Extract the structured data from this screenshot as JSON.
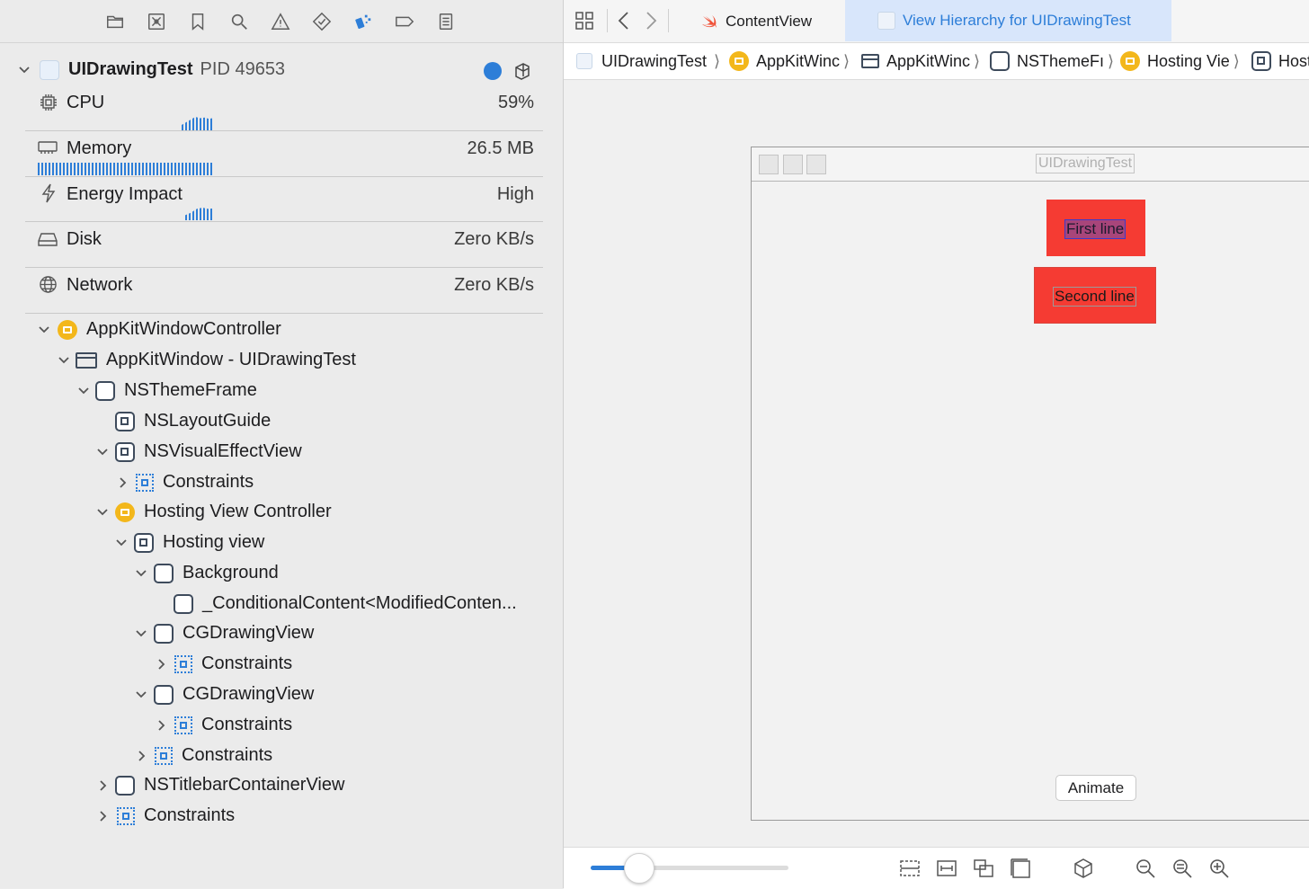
{
  "toolbar": {
    "icons": [
      "folder-icon",
      "source-control-icon",
      "bookmark-icon",
      "find-icon",
      "warning-icon",
      "test-icon",
      "debug-icon",
      "breakpoint-icon",
      "report-icon"
    ]
  },
  "process": {
    "name": "UIDrawingTest",
    "pid": "PID 49653"
  },
  "gauges": [
    {
      "label": "CPU",
      "value": "59%"
    },
    {
      "label": "Memory",
      "value": "26.5 MB"
    },
    {
      "label": "Energy Impact",
      "value": "High"
    },
    {
      "label": "Disk",
      "value": "Zero KB/s"
    },
    {
      "label": "Network",
      "value": "Zero KB/s"
    }
  ],
  "tree": [
    {
      "label": "AppKitWindowController"
    },
    {
      "label": "AppKitWindow - UIDrawingTest"
    },
    {
      "label": "NSThemeFrame"
    },
    {
      "label": "NSLayoutGuide"
    },
    {
      "label": "NSVisualEffectView"
    },
    {
      "label": "Constraints"
    },
    {
      "label": "Hosting View Controller"
    },
    {
      "label": "Hosting view"
    },
    {
      "label": "Background"
    },
    {
      "label": "_ConditionalContent<ModifiedConten..."
    },
    {
      "label": "CGDrawingView"
    },
    {
      "label": "Constraints"
    },
    {
      "label": "CGDrawingView"
    },
    {
      "label": "Constraints"
    },
    {
      "label": "Constraints"
    },
    {
      "label": "NSTitlebarContainerView"
    },
    {
      "label": "Constraints"
    }
  ],
  "tabs": [
    {
      "label": "ContentView"
    },
    {
      "label": "View Hierarchy for UIDrawingTest"
    }
  ],
  "jumpbar": [
    {
      "label": "UIDrawingTest"
    },
    {
      "label": "AppKitWinc"
    },
    {
      "label": "AppKitWinc"
    },
    {
      "label": "NSThemeFı"
    },
    {
      "label": "Hosting Vie"
    },
    {
      "label": "Host"
    }
  ],
  "preview": {
    "window_title": "UIDrawingTest",
    "first_line": "First line",
    "second_line": "Second line",
    "button": "Animate"
  },
  "colors": {
    "accent": "#2d7ed8",
    "red_box": "#f53b33",
    "controller": "#f3b71b"
  }
}
